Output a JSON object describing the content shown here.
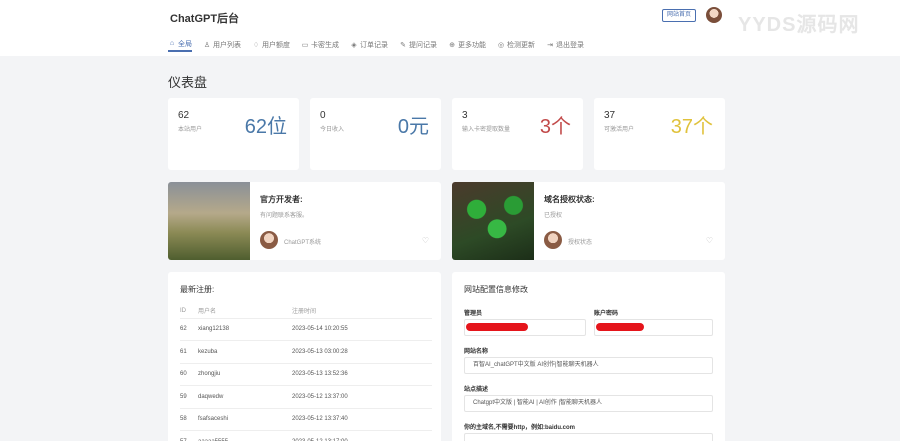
{
  "header": {
    "brand": "ChatGPT后台",
    "home_button": "网站首页",
    "watermark": "YYDS源码网"
  },
  "nav": [
    {
      "label": "全局",
      "icon": "⌂",
      "active": true
    },
    {
      "label": "用户列表",
      "icon": "♙"
    },
    {
      "label": "用户额度",
      "icon": "♢"
    },
    {
      "label": "卡密生成",
      "icon": "▭"
    },
    {
      "label": "订单记录",
      "icon": "◈"
    },
    {
      "label": "提问记录",
      "icon": "✎"
    },
    {
      "label": "更多功能",
      "icon": "⊕"
    },
    {
      "label": "检测更新",
      "icon": "◎"
    },
    {
      "label": "退出登录",
      "icon": "⇥"
    }
  ],
  "page_title": "仪表盘",
  "stats": [
    {
      "value": "62",
      "label": "本站用户",
      "big": "62位",
      "color": "#4a78a8"
    },
    {
      "value": "0",
      "label": "今日收入",
      "big": "0元",
      "color": "#4a78a8"
    },
    {
      "value": "3",
      "label": "输入卡密提取数量",
      "big": "3个",
      "color": "#c24a4a"
    },
    {
      "value": "37",
      "label": "可激活用户",
      "big": "37个",
      "color": "#e0c23c"
    }
  ],
  "features": [
    {
      "title": "官方开发者:",
      "subtitle": "有问题联系客服。",
      "author": "ChatGPT系统"
    },
    {
      "title": "域名授权状态:",
      "subtitle": "已授权",
      "author": "授权状态"
    }
  ],
  "registrations": {
    "title": "最新注册:",
    "headers": [
      "ID",
      "用户名",
      "注册时间"
    ],
    "rows": [
      [
        "62",
        "xiang12138",
        "2023-05-14 10:20:55"
      ],
      [
        "61",
        "kezuba",
        "2023-05-13 03:00:28"
      ],
      [
        "60",
        "zhongjiu",
        "2023-05-13 13:52:36"
      ],
      [
        "59",
        "daqwedw",
        "2023-05-12 13:37:00"
      ],
      [
        "58",
        "fsafsaceshi",
        "2023-05-12 13:37:40"
      ],
      [
        "57",
        "aaaaa5555",
        "2023-05-12 13:17:00"
      ]
    ]
  },
  "config": {
    "title": "网站配置信息修改",
    "admin_label": "管理员",
    "password_label": "账户密码",
    "site_name_label": "网站名称",
    "site_name_value": "百智AI_chatGPT中文版 AI创作|智能聊天机器人",
    "site_desc_label": "站点描述",
    "site_desc_value": "Chatgpt中文版 | 智能AI | AI创作 |智能聊天机器人",
    "domain_label": "你的主域名,不需要http，例如:baidu.com"
  },
  "colors": {
    "accent": "#4a6fb0",
    "redaction": "#e5141b"
  }
}
